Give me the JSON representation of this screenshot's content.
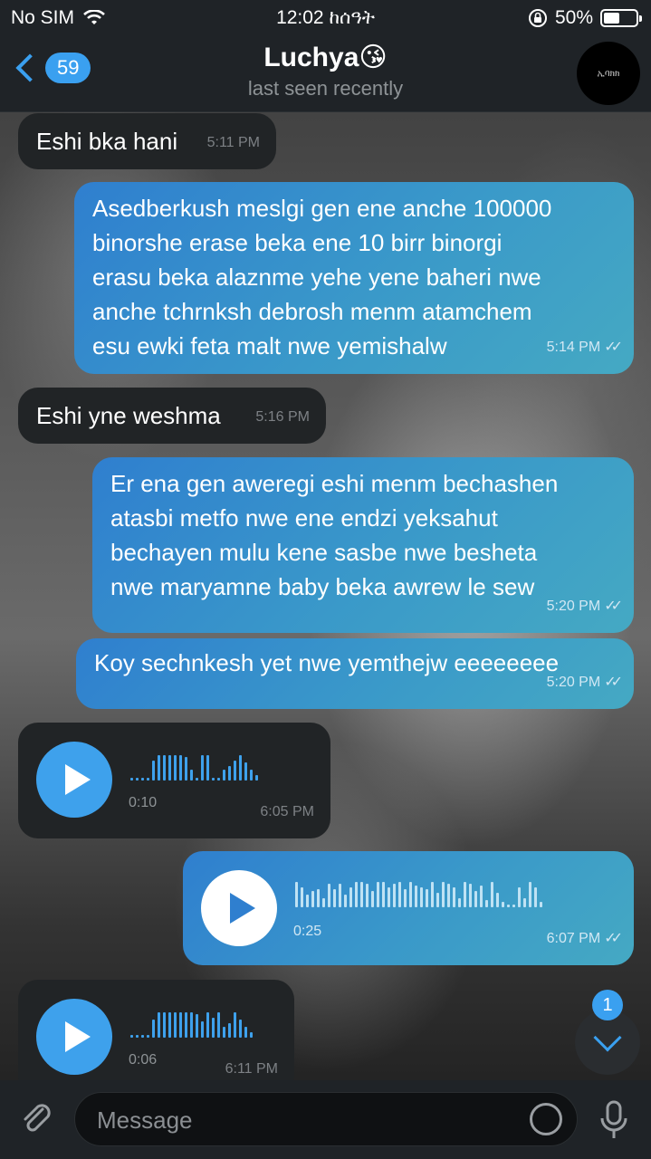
{
  "status_bar": {
    "carrier": "No SIM",
    "time": "12:02 ከሰዓት",
    "battery": "50%",
    "battery_level": 0.5
  },
  "header": {
    "back_count": "59",
    "title": "Luchya😘",
    "subtitle": "last seen recently",
    "avatar_text": "ኢባክክ"
  },
  "messages": [
    {
      "direction": "in",
      "text": "Eshi bka hani",
      "time": "5:11 PM"
    },
    {
      "direction": "out",
      "text": "Asedberkush meslgi gen ene anche 100000\nbinorshe erase beka ene 10 birr binorgi\nerasu beka alaznme yehe yene baheri nwe\nanche tchrnksh debrosh menm atamchem\nesu ewki feta malt nwe yemishalw",
      "time": "5:14 PM"
    },
    {
      "direction": "in",
      "text": "Eshi yne weshma",
      "time": "5:16 PM"
    },
    {
      "direction": "out",
      "text": "Er ena gen aweregi eshi menm bechashen\natasbi metfo nwe ene endzi yeksahut\nbechayen mulu kene sasbe nwe besheta\nnwe maryamne baby beka awrew le sew",
      "time": "5:20 PM"
    },
    {
      "direction": "out",
      "text": "Koy sechnkesh yet nwe yemthejw eeeeeeee",
      "time": "5:20 PM"
    },
    {
      "direction": "in",
      "type": "voice",
      "duration": "0:10",
      "time": "6:05 PM"
    },
    {
      "direction": "out",
      "type": "voice",
      "duration": "0:25",
      "time": "6:07 PM"
    },
    {
      "direction": "in",
      "type": "voice",
      "duration": "0:06",
      "time": "6:11 PM"
    }
  ],
  "scroll_badge": "1",
  "input": {
    "placeholder": "Message"
  },
  "icons": [
    "wifi-icon",
    "lock-rotation-icon",
    "battery-icon",
    "back-chevron-icon",
    "play-icon",
    "double-check-icon",
    "chevron-down-icon",
    "paperclip-icon",
    "sticker-icon",
    "microphone-icon"
  ]
}
